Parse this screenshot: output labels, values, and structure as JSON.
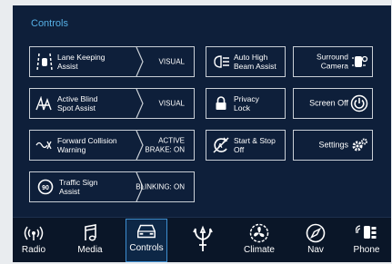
{
  "section_title": "Controls",
  "left_tiles": [
    {
      "label_1": "Lane Keeping",
      "label_2": "Assist",
      "status_1": "VISUAL",
      "status_2": ""
    },
    {
      "label_1": "Active Blind",
      "label_2": "Spot Assist",
      "status_1": "VISUAL",
      "status_2": ""
    },
    {
      "label_1": "Forward Collision",
      "label_2": "Warning",
      "status_1": "ACTIVE",
      "status_2": "BRAKE: ON"
    },
    {
      "label_1": "Traffic Sign",
      "label_2": "Assist",
      "status_1": "BLINKING: ON",
      "status_2": ""
    }
  ],
  "mid_tiles": [
    {
      "label_1": "Auto High",
      "label_2": "Beam Assist"
    },
    {
      "label_1": "Privacy",
      "label_2": "Lock"
    },
    {
      "label_1": "Start & Stop",
      "label_2": "Off"
    }
  ],
  "right_tiles": [
    {
      "label_1": "Surround",
      "label_2": "Camera"
    },
    {
      "label_1": "Screen Off",
      "label_2": ""
    },
    {
      "label_1": "Settings",
      "label_2": ""
    }
  ],
  "traffic_sign_speed": "90",
  "nav": [
    {
      "label": "Radio",
      "icon": "radio-icon"
    },
    {
      "label": "Media",
      "icon": "music-note-icon"
    },
    {
      "label": "Controls",
      "icon": "car-icon"
    },
    {
      "label": "",
      "icon": "trident-logo-icon"
    },
    {
      "label": "Climate",
      "icon": "climate-fan-icon"
    },
    {
      "label": "Nav",
      "icon": "compass-icon"
    },
    {
      "label": "Phone",
      "icon": "phone-icon"
    }
  ],
  "colors": {
    "accent": "#56b0e6",
    "background": "#0e1f3a",
    "active_border": "#3e8ed0"
  }
}
